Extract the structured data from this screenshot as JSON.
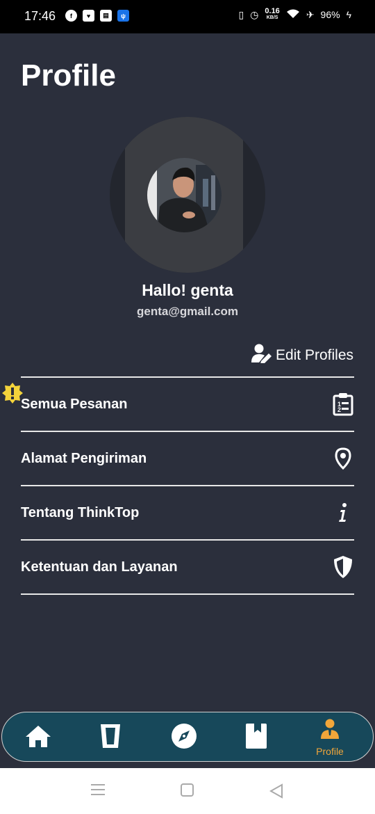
{
  "status_bar": {
    "time": "17:46",
    "net_speed": "0.16",
    "net_unit": "KB/S",
    "battery": "96%",
    "app_icons": [
      "facebook-icon",
      "lazada-icon",
      "news-icon",
      "usb-icon"
    ]
  },
  "page": {
    "title": "Profile"
  },
  "profile": {
    "greeting": "Hallo! genta",
    "email": "genta@gmail.com"
  },
  "edit": {
    "label": "Edit Profiles"
  },
  "menu": {
    "items": [
      {
        "label": "Semua Pesanan",
        "icon": "clipboard-list-icon"
      },
      {
        "label": "Alamat Pengiriman",
        "icon": "map-pin-icon"
      },
      {
        "label": "Tentang ThinkTop",
        "icon": "info-icon"
      },
      {
        "label": "Ketentuan dan Layanan",
        "icon": "shield-icon"
      }
    ]
  },
  "bottom_nav": {
    "items": [
      {
        "icon": "home-icon",
        "label": ""
      },
      {
        "icon": "cup-icon",
        "label": ""
      },
      {
        "icon": "compass-icon",
        "label": ""
      },
      {
        "icon": "bookmark-icon",
        "label": ""
      },
      {
        "icon": "profile-icon",
        "label": "Profile",
        "active": true
      }
    ],
    "active_color": "#f2a63a"
  },
  "colors": {
    "background": "#2b2f3c",
    "nav_bg": "#17485a",
    "accent": "#f2a63a",
    "warning": "#f3d33b"
  }
}
